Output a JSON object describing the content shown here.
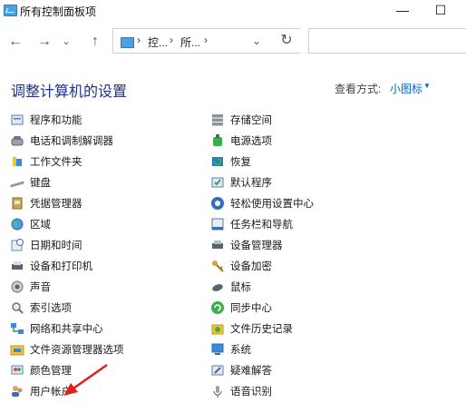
{
  "window": {
    "title": "所有控制面板项",
    "minimize": "—",
    "maximize": "☐"
  },
  "nav": {
    "back": "←",
    "forward": "→",
    "recent": "⌄",
    "up": "↑",
    "breadcrumb": [
      "控...",
      "所..."
    ],
    "separator": "›",
    "dropdown": "⌄",
    "refresh": "↻"
  },
  "header": {
    "title": "调整计算机的设置",
    "view_label": "查看方式:",
    "view_value": "小图标",
    "view_caret": "▼"
  },
  "items_left": [
    {
      "label": "程序和功能",
      "icon": "programs-icon"
    },
    {
      "label": "电话和调制解调器",
      "icon": "phone-modem-icon"
    },
    {
      "label": "工作文件夹",
      "icon": "work-folders-icon"
    },
    {
      "label": "键盘",
      "icon": "keyboard-icon"
    },
    {
      "label": "凭据管理器",
      "icon": "credential-manager-icon"
    },
    {
      "label": "区域",
      "icon": "region-icon"
    },
    {
      "label": "日期和时间",
      "icon": "date-time-icon"
    },
    {
      "label": "设备和打印机",
      "icon": "devices-printers-icon"
    },
    {
      "label": "声音",
      "icon": "sound-icon"
    },
    {
      "label": "索引选项",
      "icon": "indexing-options-icon"
    },
    {
      "label": "网络和共享中心",
      "icon": "network-sharing-icon"
    },
    {
      "label": "文件资源管理器选项",
      "icon": "file-explorer-options-icon"
    },
    {
      "label": "颜色管理",
      "icon": "color-management-icon"
    },
    {
      "label": "用户帐户",
      "icon": "user-accounts-icon"
    }
  ],
  "items_right": [
    {
      "label": "存储空间",
      "icon": "storage-spaces-icon"
    },
    {
      "label": "电源选项",
      "icon": "power-options-icon"
    },
    {
      "label": "恢复",
      "icon": "recovery-icon"
    },
    {
      "label": "默认程序",
      "icon": "default-programs-icon"
    },
    {
      "label": "轻松使用设置中心",
      "icon": "ease-of-access-icon"
    },
    {
      "label": "任务栏和导航",
      "icon": "taskbar-navigation-icon"
    },
    {
      "label": "设备管理器",
      "icon": "device-manager-icon"
    },
    {
      "label": "设备加密",
      "icon": "device-encryption-icon"
    },
    {
      "label": "鼠标",
      "icon": "mouse-icon"
    },
    {
      "label": "同步中心",
      "icon": "sync-center-icon"
    },
    {
      "label": "文件历史记录",
      "icon": "file-history-icon"
    },
    {
      "label": "系统",
      "icon": "system-icon"
    },
    {
      "label": "疑难解答",
      "icon": "troubleshooting-icon"
    },
    {
      "label": "语音识别",
      "icon": "speech-recognition-icon"
    }
  ],
  "colors": {
    "heading": "#1e3287",
    "link": "#0066cc",
    "annotation_arrow": "#e02020"
  }
}
